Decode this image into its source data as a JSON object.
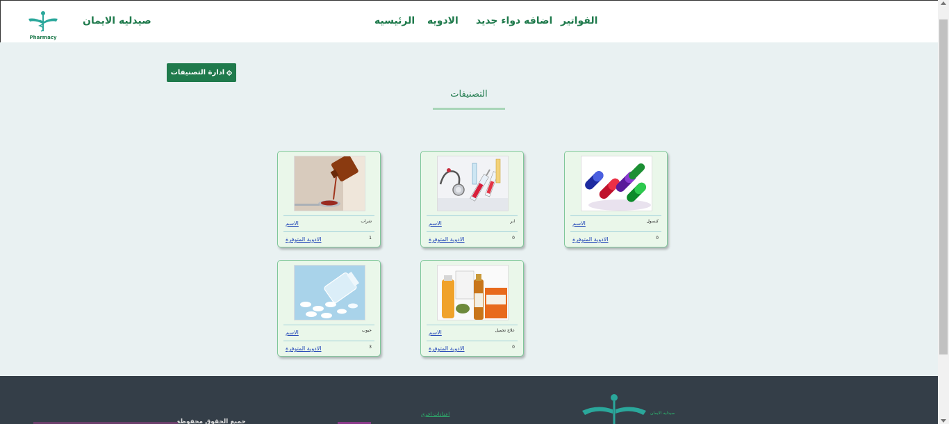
{
  "header": {
    "brand": "صيدليه الايمان",
    "logo_text": "Pharmacy",
    "nav": {
      "invoices": "الفواتير",
      "add_medicine": "اضافه دواء جديد",
      "medicines": "الادويه",
      "home": "الرئيسيه"
    }
  },
  "main": {
    "manage_button": "ادارة التصنيفات",
    "manage_icon": "gear-icon",
    "section_title": "التصنيفات"
  },
  "categories": [
    {
      "name": "كبسول",
      "name_label": "الاسم",
      "count": "0",
      "available_label": "الادوية المتوفرة",
      "image": "capsules-image"
    },
    {
      "name": "ابر",
      "name_label": "الاسم",
      "count": "0",
      "available_label": "الادوية المتوفرة",
      "image": "syringes-image"
    },
    {
      "name": "شراب",
      "name_label": "الاسم",
      "count": "1",
      "available_label": "الادوية المتوفرة",
      "image": "syrup-image"
    },
    {
      "name": "علاج تجميل",
      "name_label": "الاسم",
      "count": "0",
      "available_label": "الادوية المتوفرة",
      "image": "cosmetic-products-image"
    },
    {
      "name": "حبوب",
      "name_label": "الاسم",
      "count": "3",
      "available_label": "الادوية المتوفرة",
      "image": "pills-image"
    }
  ],
  "footer": {
    "brand": "صيدليه الايمان",
    "settings_link": "اعدادات اخري",
    "cut_text": "جميع الحقوق محفوظة"
  },
  "colors": {
    "accent": "#1f7a4c",
    "footer_bg": "#343e48",
    "card_bg": "#eaf7ea",
    "page_bg": "#e9f1f2"
  }
}
